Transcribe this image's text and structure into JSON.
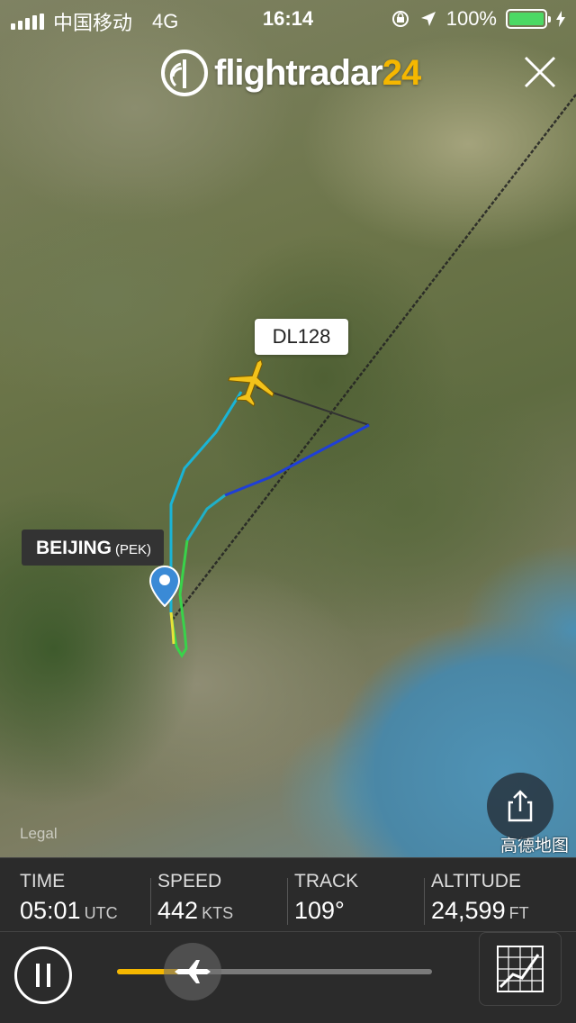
{
  "status_bar": {
    "carrier": "中国移动",
    "network": "4G",
    "time": "16:14",
    "battery_percent": "100%",
    "battery_level": 1.0,
    "signal_icon": "signal-bars-icon",
    "lock_icon": "orientation-lock-icon",
    "location_icon": "location-arrow-icon",
    "charging_icon": "charging-bolt-icon"
  },
  "header": {
    "logo_text": "flightradar",
    "logo_number": "24",
    "close_icon": "close-icon"
  },
  "map": {
    "flight_label": "DL128",
    "airport_name": "BEIJING",
    "airport_code": "(PEK)",
    "legal_text": "Legal",
    "provider_text": "高德地图",
    "share_icon": "share-icon"
  },
  "flight_info": {
    "time_label": "TIME",
    "time_value": "05:01",
    "time_unit": "UTC",
    "speed_label": "SPEED",
    "speed_value": "442",
    "speed_unit": "KTS",
    "track_label": "TRACK",
    "track_value": "109°",
    "altitude_label": "ALTITUDE",
    "altitude_value": "24,599",
    "altitude_unit": "FT"
  },
  "playback": {
    "pause_icon": "pause-icon",
    "progress_fraction": 0.25,
    "handle_icon": "airplane-icon",
    "chart_icon": "altitude-chart-icon"
  },
  "colors": {
    "accent": "#f5b700",
    "panel": "#2b2b2b",
    "plane": "#f2c21a",
    "pin": "#3a8ad6"
  }
}
